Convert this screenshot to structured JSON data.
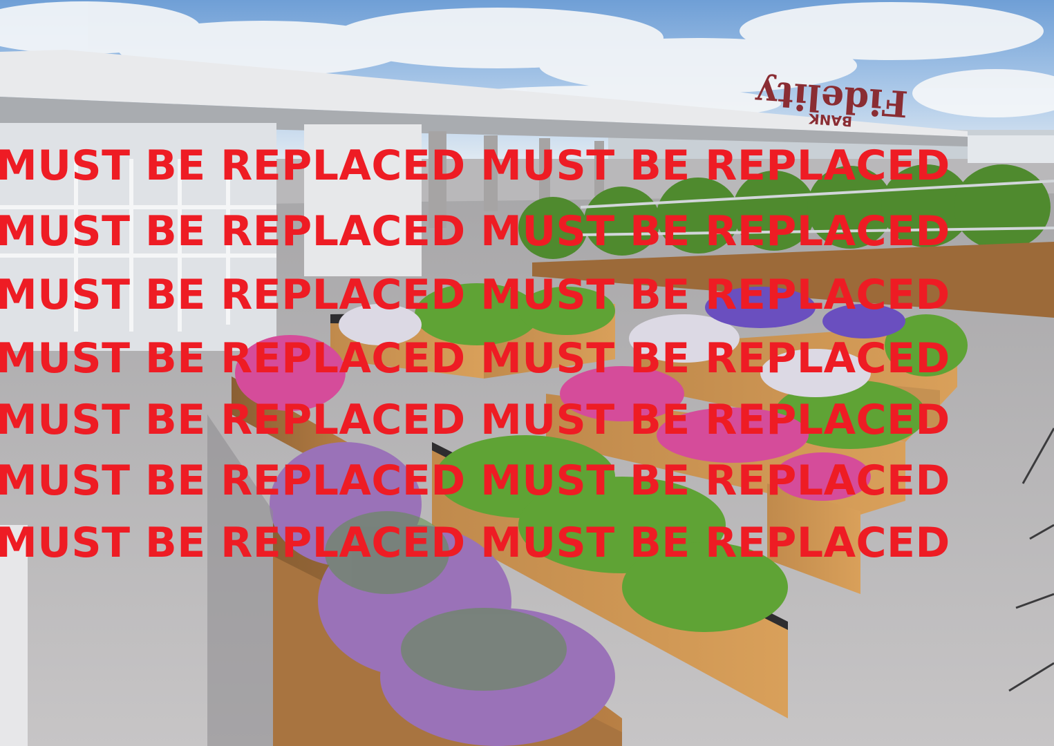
{
  "scene": {
    "sign": {
      "brand": "Fidelity",
      "sub": "BANK"
    }
  },
  "overlay": {
    "lines": [
      "MUST BE REPLACED MUST BE REPLACED",
      "MUST BE REPLACED MUST BE REPLACED",
      "MUST BE REPLACED MUST BE REPLACED",
      "MUST BE REPLACED MUST BE REPLACED",
      "MUST BE REPLACED MUST BE REPLACED",
      "MUST BE REPLACED MUST BE REPLACED",
      "MUST BE REPLACED MUST BE REPLACED"
    ],
    "color": "#ee1c24"
  }
}
